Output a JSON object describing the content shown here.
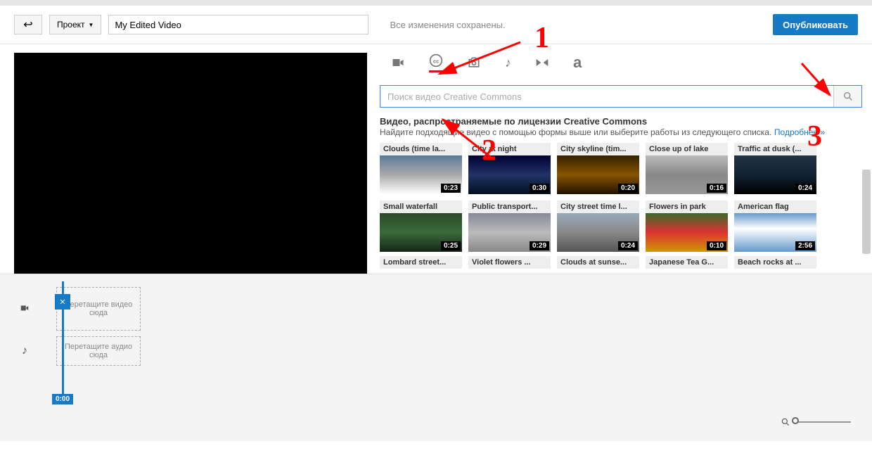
{
  "header": {
    "project_label": "Проект",
    "title": "My Edited Video",
    "save_status": "Все изменения сохранены.",
    "publish_label": "Опубликовать"
  },
  "tabs": {
    "video": "video-camera",
    "cc": "creative-commons",
    "photo": "camera",
    "audio": "music-note",
    "transition": "transition",
    "text": "text-a"
  },
  "search": {
    "placeholder": "Поиск видео Creative Commons"
  },
  "cc_section": {
    "title": "Видео, распространяемые по лицензии Creative Commons",
    "subtitle": "Найдите подходящие видео с помощью формы выше или выберите работы из следующего списка.",
    "more_link": "Подробнее »"
  },
  "videos": [
    {
      "title": "Clouds (time la...",
      "duration": "0:23"
    },
    {
      "title": "City at night",
      "duration": "0:30"
    },
    {
      "title": "City skyline (tim...",
      "duration": "0:20"
    },
    {
      "title": "Close up of lake",
      "duration": "0:16"
    },
    {
      "title": "Traffic at dusk (...",
      "duration": "0:24"
    },
    {
      "title": "Small waterfall",
      "duration": "0:25"
    },
    {
      "title": "Public transport...",
      "duration": "0:29"
    },
    {
      "title": "City street time l...",
      "duration": "0:24"
    },
    {
      "title": "Flowers in park",
      "duration": "0:10"
    },
    {
      "title": "American flag",
      "duration": "2:56"
    }
  ],
  "videos_partial": [
    "Lombard street...",
    "Violet flowers ...",
    "Clouds at sunse...",
    "Japanese Tea G...",
    "Beach rocks at ..."
  ],
  "timeline": {
    "drop_video": "Перетащите видео сюда",
    "drop_audio": "Перетащите аудио сюда",
    "time": "0:00"
  },
  "annotations": {
    "n1": "1",
    "n2": "2",
    "n3": "3"
  }
}
